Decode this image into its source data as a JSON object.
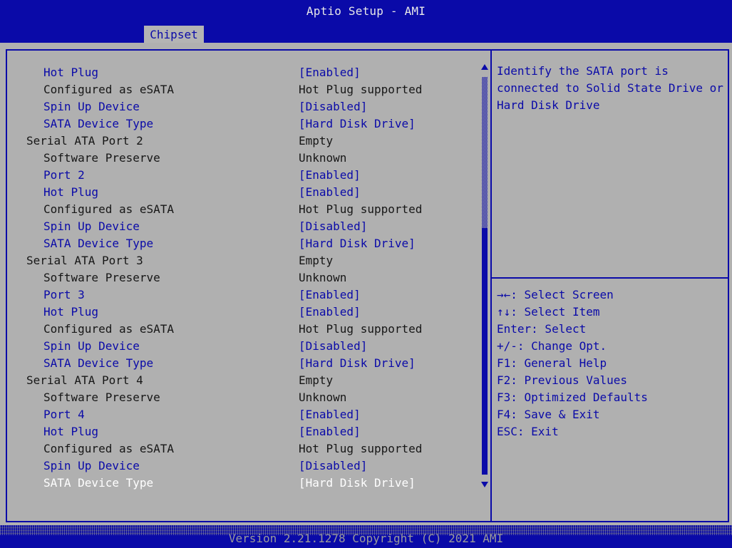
{
  "header": {
    "title": "Aptio Setup - AMI",
    "active_tab": "Chipset"
  },
  "colors": {
    "header_blue": "#0a0aa8",
    "panel_gray": "#b0b0b0",
    "selectable_text": "#0a0aa8",
    "info_text": "#161616",
    "highlight_text": "#ffffff"
  },
  "settings": [
    {
      "label": "Hot Plug",
      "value": "[Enabled]",
      "indent": 1,
      "kind": "sel"
    },
    {
      "label": "Configured as eSATA",
      "value": "Hot Plug supported",
      "indent": 1,
      "kind": "info"
    },
    {
      "label": "Spin Up Device",
      "value": "[Disabled]",
      "indent": 1,
      "kind": "sel"
    },
    {
      "label": "SATA Device Type",
      "value": "[Hard Disk Drive]",
      "indent": 1,
      "kind": "sel"
    },
    {
      "label": "Serial ATA Port 2",
      "value": "Empty",
      "indent": 0,
      "kind": "info"
    },
    {
      "label": "Software Preserve",
      "value": "Unknown",
      "indent": 1,
      "kind": "info"
    },
    {
      "label": "Port 2",
      "value": "[Enabled]",
      "indent": 1,
      "kind": "sel"
    },
    {
      "label": "Hot Plug",
      "value": "[Enabled]",
      "indent": 1,
      "kind": "sel"
    },
    {
      "label": "Configured as eSATA",
      "value": "Hot Plug supported",
      "indent": 1,
      "kind": "info"
    },
    {
      "label": "Spin Up Device",
      "value": "[Disabled]",
      "indent": 1,
      "kind": "sel"
    },
    {
      "label": "SATA Device Type",
      "value": "[Hard Disk Drive]",
      "indent": 1,
      "kind": "sel"
    },
    {
      "label": "Serial ATA Port 3",
      "value": "Empty",
      "indent": 0,
      "kind": "info"
    },
    {
      "label": "Software Preserve",
      "value": "Unknown",
      "indent": 1,
      "kind": "info"
    },
    {
      "label": "Port 3",
      "value": "[Enabled]",
      "indent": 1,
      "kind": "sel"
    },
    {
      "label": "Hot Plug",
      "value": "[Enabled]",
      "indent": 1,
      "kind": "sel"
    },
    {
      "label": "Configured as eSATA",
      "value": "Hot Plug supported",
      "indent": 1,
      "kind": "info"
    },
    {
      "label": "Spin Up Device",
      "value": "[Disabled]",
      "indent": 1,
      "kind": "sel"
    },
    {
      "label": "SATA Device Type",
      "value": "[Hard Disk Drive]",
      "indent": 1,
      "kind": "sel"
    },
    {
      "label": "Serial ATA Port 4",
      "value": "Empty",
      "indent": 0,
      "kind": "info"
    },
    {
      "label": "Software Preserve",
      "value": "Unknown",
      "indent": 1,
      "kind": "info"
    },
    {
      "label": "Port 4",
      "value": "[Enabled]",
      "indent": 1,
      "kind": "sel"
    },
    {
      "label": "Hot Plug",
      "value": "[Enabled]",
      "indent": 1,
      "kind": "sel"
    },
    {
      "label": "Configured as eSATA",
      "value": "Hot Plug supported",
      "indent": 1,
      "kind": "info"
    },
    {
      "label": "Spin Up Device",
      "value": "[Disabled]",
      "indent": 1,
      "kind": "sel"
    },
    {
      "label": "SATA Device Type",
      "value": "[Hard Disk Drive]",
      "indent": 1,
      "kind": "hl"
    }
  ],
  "scrollbar": {
    "thumb_start": 0.38,
    "thumb_end": 1.0
  },
  "help_text": "Identify the SATA port is connected to Solid State Drive or Hard Disk Drive",
  "key_help": [
    "→←: Select Screen",
    "↑↓: Select Item",
    "Enter: Select",
    "+/-: Change Opt.",
    "F1: General Help",
    "F2: Previous Values",
    "F3: Optimized Defaults",
    "F4: Save & Exit",
    "ESC: Exit"
  ],
  "footer": {
    "version": "Version 2.21.1278 Copyright (C) 2021 AMI"
  }
}
